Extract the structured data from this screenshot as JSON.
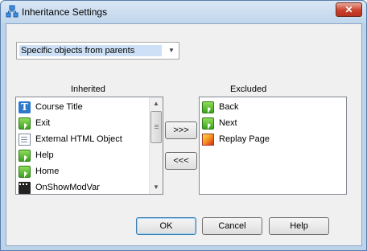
{
  "window": {
    "title": "Inheritance Settings",
    "close_glyph": "✕"
  },
  "combo": {
    "value": "Specific objects from parents",
    "arrow": "▼"
  },
  "inherited": {
    "label": "Inherited",
    "items": [
      {
        "label": "Course Title",
        "icon": "text-icon"
      },
      {
        "label": "Exit",
        "icon": "button-icon"
      },
      {
        "label": "External HTML Object",
        "icon": "html-object-icon"
      },
      {
        "label": "Help",
        "icon": "button-icon"
      },
      {
        "label": "Home",
        "icon": "button-icon"
      },
      {
        "label": "OnShowModVar",
        "icon": "variable-icon"
      }
    ]
  },
  "excluded": {
    "label": "Excluded",
    "items": [
      {
        "label": "Back",
        "icon": "button-icon"
      },
      {
        "label": "Next",
        "icon": "button-icon"
      },
      {
        "label": "Replay Page",
        "icon": "replay-page-icon"
      }
    ]
  },
  "transfer": {
    "add_label": ">>>",
    "remove_label": "<<<"
  },
  "footer": {
    "ok_label": "OK",
    "cancel_label": "Cancel",
    "help_label": "Help"
  },
  "icons": {
    "text_glyph": "T",
    "scroll_up": "▲",
    "scroll_down": "▼"
  },
  "colors": {
    "titlebar": "#c1d6ec",
    "selection": "#cde0f5",
    "close": "#c9412b"
  }
}
